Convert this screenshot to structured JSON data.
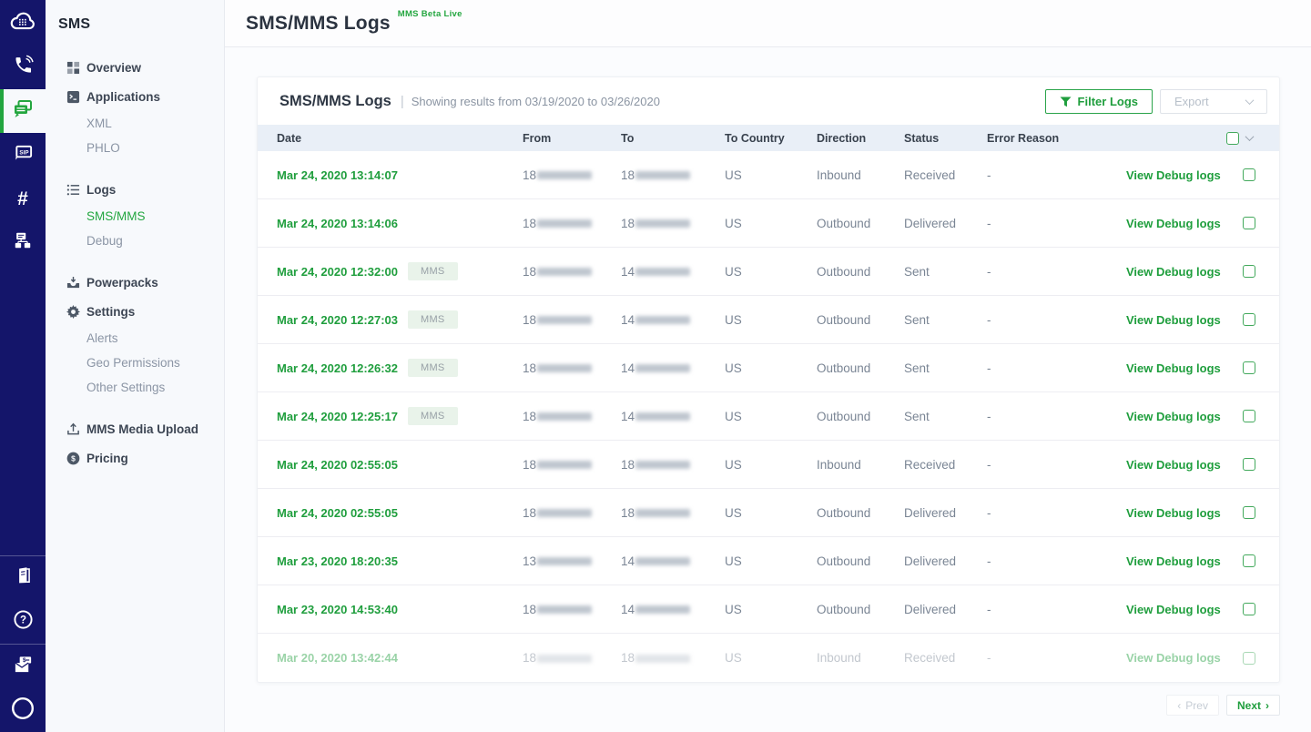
{
  "colors": {
    "rail_navy": "#14156a",
    "accent_green": "#1f9e3d",
    "sidebar_bg": "#f7f9fc",
    "table_header_bg": "#e9eff7"
  },
  "rail": {
    "icons_top": [
      "plivo-logo-icon",
      "voice-icon",
      "messaging-icon",
      "zentrunk-sip-icon",
      "phone-numbers-icon",
      "phlo-icon"
    ],
    "icons_bottom": [
      "docs-icon",
      "help-icon",
      "billing-icon",
      "account-icon"
    ],
    "glyphs": {
      "sip": "SIP",
      "hash": "#",
      "help": "?",
      "pricing_dollar": "$"
    },
    "active_icon": "messaging-icon"
  },
  "sidebar": {
    "title": "SMS",
    "items": [
      {
        "label": "Overview",
        "icon": "overview-icon",
        "type": "top"
      },
      {
        "label": "Applications",
        "icon": "applications-icon",
        "type": "top"
      },
      {
        "label": "XML",
        "type": "sub"
      },
      {
        "label": "PHLO",
        "type": "sub"
      },
      {
        "label": "Logs",
        "icon": "logs-icon",
        "type": "top",
        "group_gap": true
      },
      {
        "label": "SMS/MMS",
        "type": "sub",
        "active": true
      },
      {
        "label": "Debug",
        "type": "sub"
      },
      {
        "label": "Powerpacks",
        "icon": "powerpacks-icon",
        "type": "top",
        "group_gap": true
      },
      {
        "label": "Settings",
        "icon": "settings-icon",
        "type": "top"
      },
      {
        "label": "Alerts",
        "type": "sub"
      },
      {
        "label": "Geo Permissions",
        "type": "sub"
      },
      {
        "label": "Other Settings",
        "type": "sub"
      },
      {
        "label": "MMS Media Upload",
        "icon": "upload-icon",
        "type": "top",
        "group_gap": true
      },
      {
        "label": "Pricing",
        "icon": "pricing-icon",
        "type": "top"
      }
    ]
  },
  "header": {
    "title": "SMS/MMS Logs",
    "beta_badge": "MMS Beta Live"
  },
  "card": {
    "title": "SMS/MMS Logs",
    "separator": "|",
    "subtitle": "Showing results from 03/19/2020 to 03/26/2020",
    "filter_button": "Filter Logs",
    "export_button": "Export",
    "columns": [
      "Date",
      "From",
      "To",
      "To Country",
      "Direction",
      "Status",
      "Error Reason"
    ],
    "debug_link_label": "View Debug logs",
    "mms_badge_label": "MMS",
    "rows": [
      {
        "date": "Mar 24, 2020 13:14:07",
        "mms": false,
        "from_prefix": "18",
        "from_redacted": true,
        "to_prefix": "18",
        "to_redacted": true,
        "to_country": "US",
        "direction": "Inbound",
        "status": "Received",
        "error_reason": "-",
        "faded": false
      },
      {
        "date": "Mar 24, 2020 13:14:06",
        "mms": false,
        "from_prefix": "18",
        "from_redacted": true,
        "to_prefix": "18",
        "to_redacted": true,
        "to_country": "US",
        "direction": "Outbound",
        "status": "Delivered",
        "error_reason": "-",
        "faded": false
      },
      {
        "date": "Mar 24, 2020 12:32:00",
        "mms": true,
        "from_prefix": "18",
        "from_redacted": true,
        "to_prefix": "14",
        "to_redacted": true,
        "to_country": "US",
        "direction": "Outbound",
        "status": "Sent",
        "error_reason": "-",
        "faded": false
      },
      {
        "date": "Mar 24, 2020 12:27:03",
        "mms": true,
        "from_prefix": "18",
        "from_redacted": true,
        "to_prefix": "14",
        "to_redacted": true,
        "to_country": "US",
        "direction": "Outbound",
        "status": "Sent",
        "error_reason": "-",
        "faded": false
      },
      {
        "date": "Mar 24, 2020 12:26:32",
        "mms": true,
        "from_prefix": "18",
        "from_redacted": true,
        "to_prefix": "14",
        "to_redacted": true,
        "to_country": "US",
        "direction": "Outbound",
        "status": "Sent",
        "error_reason": "-",
        "faded": false
      },
      {
        "date": "Mar 24, 2020 12:25:17",
        "mms": true,
        "from_prefix": "18",
        "from_redacted": true,
        "to_prefix": "14",
        "to_redacted": true,
        "to_country": "US",
        "direction": "Outbound",
        "status": "Sent",
        "error_reason": "-",
        "faded": false
      },
      {
        "date": "Mar 24, 2020 02:55:05",
        "mms": false,
        "from_prefix": "18",
        "from_redacted": true,
        "to_prefix": "18",
        "to_redacted": true,
        "to_country": "US",
        "direction": "Inbound",
        "status": "Received",
        "error_reason": "-",
        "faded": false
      },
      {
        "date": "Mar 24, 2020 02:55:05",
        "mms": false,
        "from_prefix": "18",
        "from_redacted": true,
        "to_prefix": "18",
        "to_redacted": true,
        "to_country": "US",
        "direction": "Outbound",
        "status": "Delivered",
        "error_reason": "-",
        "faded": false
      },
      {
        "date": "Mar 23, 2020 18:20:35",
        "mms": false,
        "from_prefix": "13",
        "from_redacted": true,
        "to_prefix": "14",
        "to_redacted": true,
        "to_country": "US",
        "direction": "Outbound",
        "status": "Delivered",
        "error_reason": "-",
        "faded": false
      },
      {
        "date": "Mar 23, 2020 14:53:40",
        "mms": false,
        "from_prefix": "18",
        "from_redacted": true,
        "to_prefix": "14",
        "to_redacted": true,
        "to_country": "US",
        "direction": "Outbound",
        "status": "Delivered",
        "error_reason": "-",
        "faded": false
      },
      {
        "date": "Mar 20, 2020 13:42:44",
        "mms": false,
        "from_prefix": "18",
        "from_redacted": true,
        "to_prefix": "18",
        "to_redacted": true,
        "to_country": "US",
        "direction": "Inbound",
        "status": "Received",
        "error_reason": "-",
        "faded": true
      }
    ]
  },
  "pagination": {
    "prev_label": "Prev",
    "next_label": "Next"
  }
}
